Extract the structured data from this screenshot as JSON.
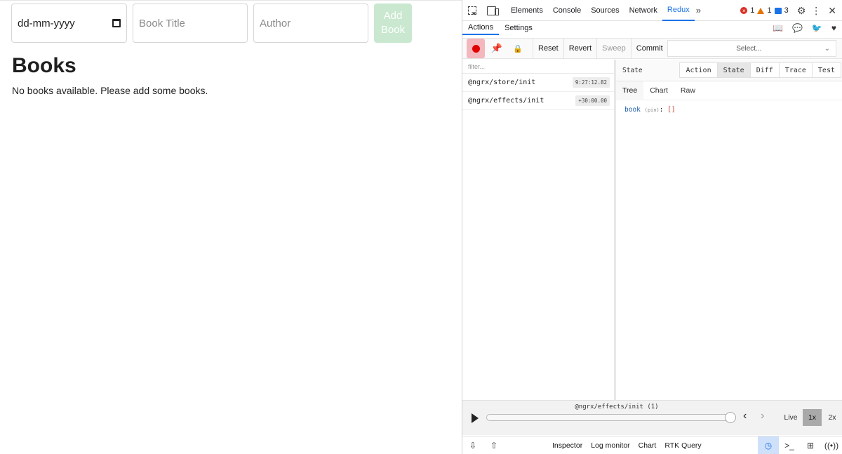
{
  "app": {
    "date_input": {
      "value": "dd-mm-yyyy"
    },
    "title_input": {
      "placeholder": "Book Title"
    },
    "author_input": {
      "placeholder": "Author"
    },
    "add_button": {
      "line1": "Add",
      "line2": "Book"
    },
    "heading": "Books",
    "empty_message": "No books available. Please add some books."
  },
  "devtools": {
    "tabs": [
      {
        "label": "Elements"
      },
      {
        "label": "Console"
      },
      {
        "label": "Sources"
      },
      {
        "label": "Network"
      },
      {
        "label": "Redux",
        "active": true
      }
    ],
    "status": {
      "errors": "1",
      "warnings": "1",
      "messages": "3"
    },
    "subtabs": [
      {
        "label": "Actions"
      },
      {
        "label": "Settings"
      }
    ],
    "toolbar": {
      "reset": "Reset",
      "revert": "Revert",
      "sweep": "Sweep",
      "commit": "Commit",
      "select_placeholder": "Select..."
    },
    "filter_placeholder": "filter...",
    "actions": [
      {
        "name": "@ngrx/store/init",
        "time": "9:27:12.82"
      },
      {
        "name": "@ngrx/effects/init",
        "time": "+30:00.00"
      }
    ],
    "state_panel": {
      "title": "State",
      "modes": [
        "Action",
        "State",
        "Diff",
        "Trace",
        "Test"
      ],
      "active_mode": "State",
      "views": [
        "Tree",
        "Chart",
        "Raw"
      ],
      "active_view": "Tree",
      "tree": {
        "key": "book",
        "pin_label": "(pin)",
        "colon": ":",
        "value": "[]"
      }
    },
    "slider": {
      "label": "@ngrx/effects/init (1)",
      "position": 1.0,
      "live": "Live",
      "speed_1x": "1x",
      "speed_2x": "2x"
    },
    "bottom_tabs": [
      "Inspector",
      "Log monitor",
      "Chart",
      "RTK Query"
    ]
  }
}
